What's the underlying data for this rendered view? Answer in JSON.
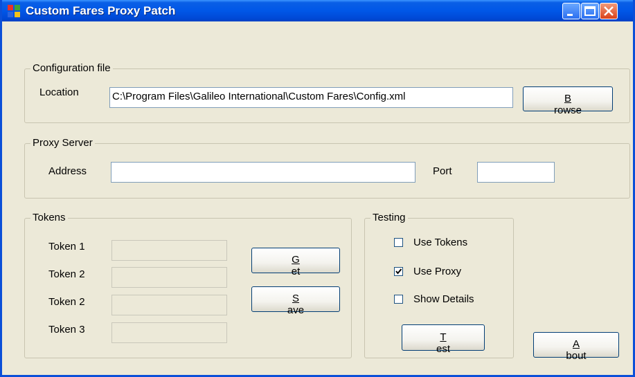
{
  "window": {
    "title": "Custom Fares Proxy Patch"
  },
  "icons": {
    "app": "app-icon",
    "minimize": "minimize-icon",
    "maximize": "maximize-icon",
    "close": "close-icon",
    "check": "check-icon"
  },
  "colors": {
    "titlebar": "#0057e7",
    "window_bg": "#ece9d8",
    "input_border": "#7f9db9",
    "button_border": "#003c74"
  },
  "config_file": {
    "legend": "Configuration  file",
    "location_label": "Location",
    "location_value": "C:\\Program Files\\Galileo International\\Custom Fares\\Config.xml",
    "browse_prefix": "",
    "browse_mnemonic": "B",
    "browse_rest": "rowse"
  },
  "proxy": {
    "legend": "Proxy Server",
    "address_label": "Address",
    "address_value": "",
    "port_label": "Port",
    "port_value": ""
  },
  "tokens": {
    "legend": "Tokens",
    "labels": [
      "Token 1",
      "Token 2",
      "Token 2",
      "Token 3"
    ],
    "values": [
      "",
      "",
      "",
      ""
    ],
    "get_mnemonic": "G",
    "get_rest": "et",
    "save_mnemonic": "S",
    "save_rest": "ave"
  },
  "testing": {
    "legend": "Testing",
    "use_tokens": {
      "label": "Use Tokens",
      "checked": false
    },
    "use_proxy": {
      "label": "Use Proxy",
      "checked": true
    },
    "show_details": {
      "label": "Show Details",
      "checked": false
    },
    "test_mnemonic": "T",
    "test_rest": "est"
  },
  "about": {
    "mnemonic": "A",
    "rest": "bout"
  }
}
